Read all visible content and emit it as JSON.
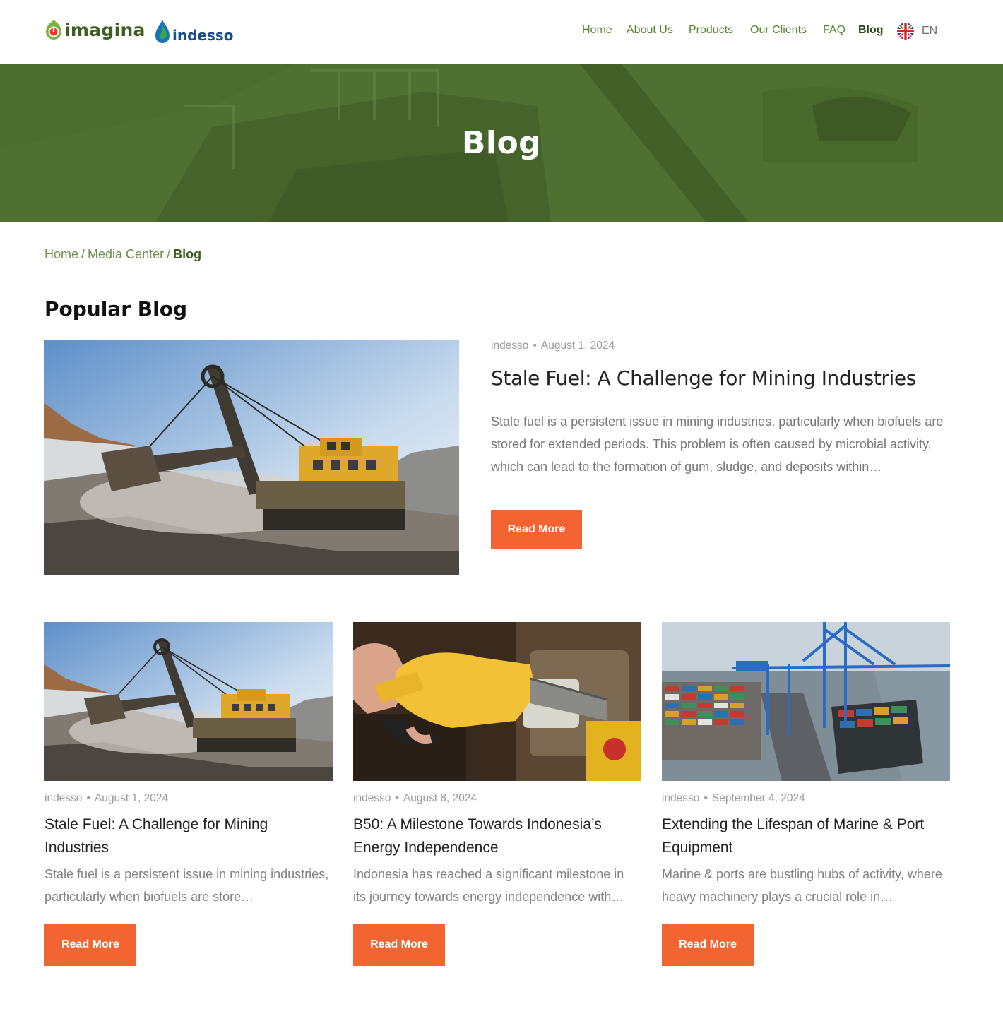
{
  "header": {
    "logo_imagina": "imagina",
    "logo_indesso": "indesso",
    "nav": [
      {
        "label": "Home",
        "active": false
      },
      {
        "label": "About Us",
        "active": false
      },
      {
        "label": "Products",
        "active": false
      },
      {
        "label": "Our Clients",
        "active": false
      },
      {
        "label": "FAQ",
        "active": false
      },
      {
        "label": "Blog",
        "active": true
      }
    ],
    "language": "EN"
  },
  "hero": {
    "title": "Blog"
  },
  "breadcrumb": {
    "items": [
      "Home",
      "Media Center"
    ],
    "current": "Blog"
  },
  "popular": {
    "heading": "Popular Blog",
    "featured": {
      "author": "indesso",
      "date": "August 1, 2024",
      "title": "Stale Fuel: A Challenge for Mining Industries",
      "excerpt": "Stale fuel is a persistent issue in mining industries, particularly when biofuels are stored for extended periods. This problem is often caused by microbial activity, which can lead to the formation of gum, sludge, and deposits within…",
      "button": "Read More",
      "image": "mining-excavator"
    }
  },
  "posts": [
    {
      "author": "indesso",
      "date": "August 1, 2024",
      "title": "Stale Fuel: A Challenge for Mining Industries",
      "excerpt": "Stale fuel is a persistent issue in mining industries, particularly when biofuels are store…",
      "button": "Read More",
      "image": "mining-excavator"
    },
    {
      "author": "indesso",
      "date": "August 8, 2024",
      "title": "B50: A Milestone Towards Indonesia’s Energy Independence",
      "excerpt": "Indonesia has reached a significant milestone in its journey towards energy independence with…",
      "button": "Read More",
      "image": "fuel-nozzle"
    },
    {
      "author": "indesso",
      "date": "September 4, 2024",
      "title": "Extending the Lifespan of Marine & Port Equipment",
      "excerpt": "Marine & ports are bustling hubs of activity, where heavy machinery plays a crucial role in…",
      "button": "Read More",
      "image": "container-port"
    }
  ],
  "colors": {
    "brand_green": "#58852e",
    "dark_green": "#3d5e1e",
    "accent_orange": "#f26532"
  }
}
